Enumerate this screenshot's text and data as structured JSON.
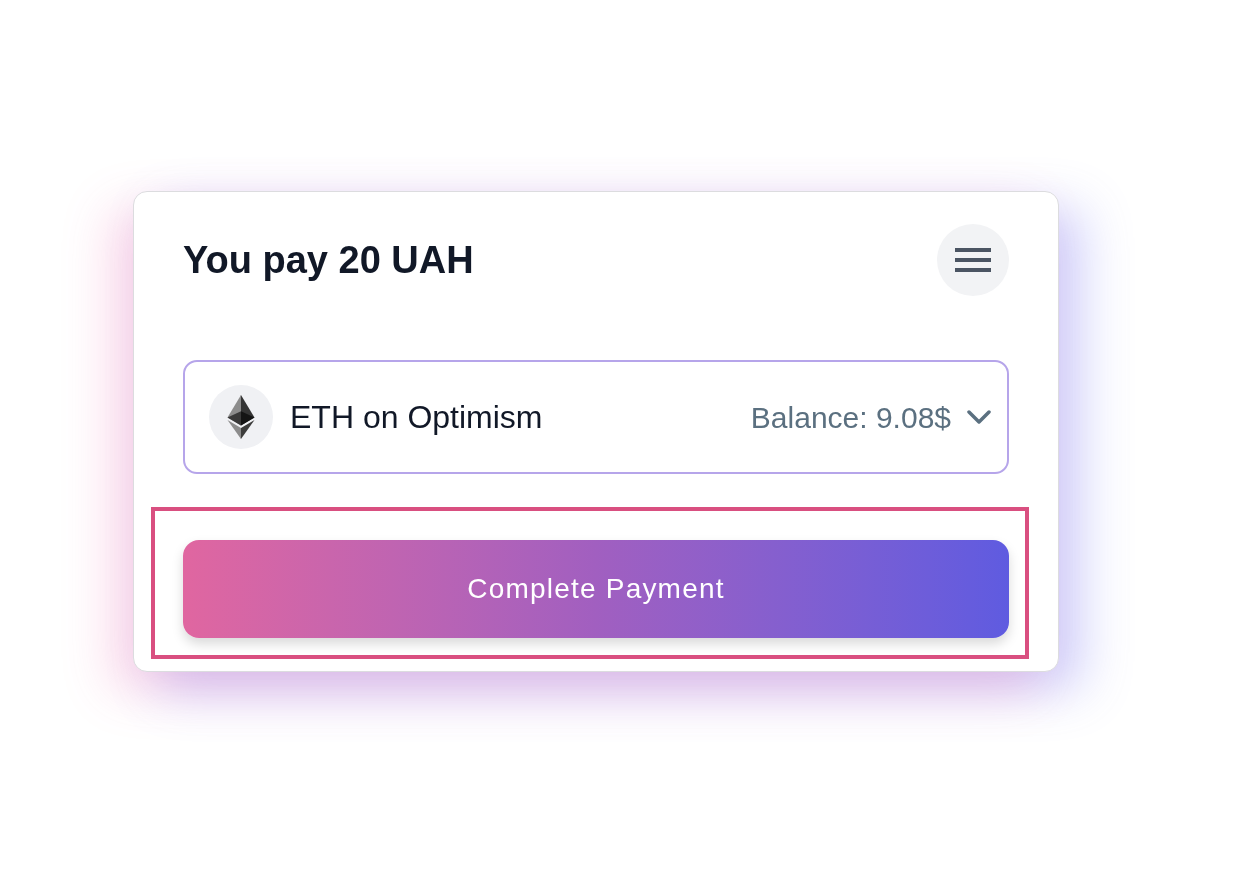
{
  "header": {
    "title": "You pay 20 UAH"
  },
  "payment_method": {
    "token": "ETH on Optimism",
    "balance": "Balance: 9.08$"
  },
  "action_button": {
    "label": "Complete Payment",
    "highlighted": true
  }
}
